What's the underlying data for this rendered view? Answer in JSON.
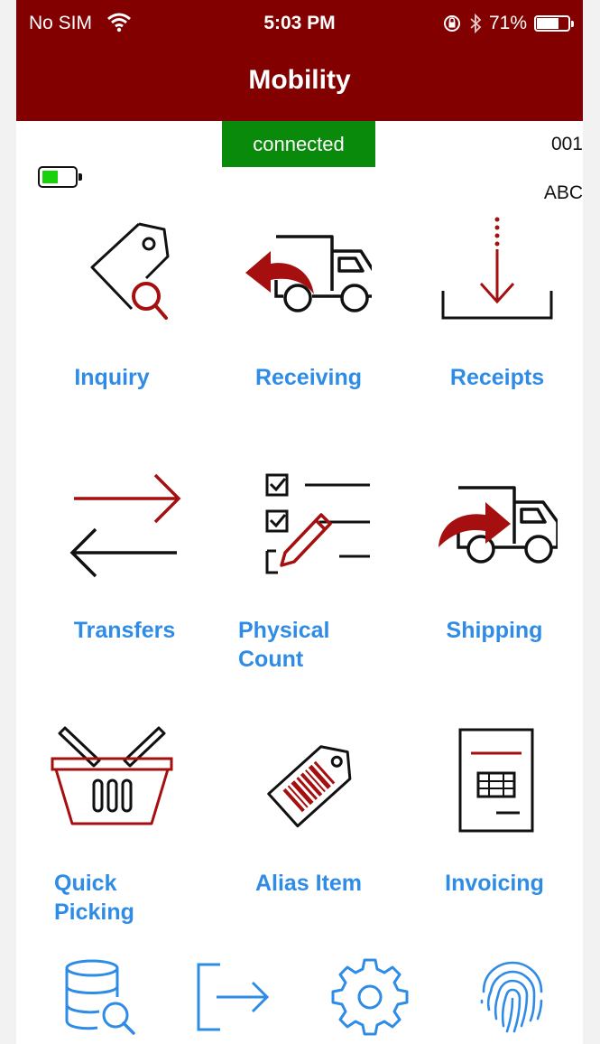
{
  "status_bar": {
    "carrier": "No SIM",
    "time": "5:03 PM",
    "battery": "71%",
    "battery_level": 0.71
  },
  "nav": {
    "title": "Mobility"
  },
  "connection": {
    "status": "connected",
    "device_id": "001",
    "device_code": "ABC",
    "device_battery_level": 0.5
  },
  "menu": {
    "inquiry": "Inquiry",
    "receiving": "Receiving",
    "receipts": "Receipts",
    "transfers": "Transfers",
    "physical_count": "Physical Count",
    "shipping": "Shipping",
    "quick_picking": "Quick Picking",
    "alias_item": "Alias Item",
    "invoicing": "Invoicing"
  },
  "bottom_bar": [
    "database-search-icon",
    "logout-icon",
    "settings-gear-icon",
    "fingerprint-icon"
  ],
  "colors": {
    "nav_bar": "#820000",
    "label_blue": "#2f8ce6",
    "connected_green": "#0a8a0a",
    "accent_red": "#a50f0f"
  }
}
